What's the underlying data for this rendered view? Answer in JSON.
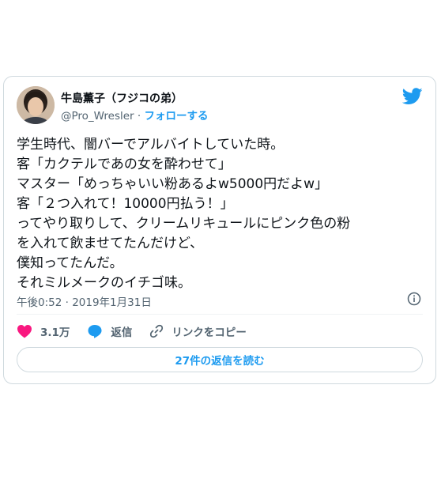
{
  "tweet": {
    "author_name": "牛島薫子（フジコの弟）",
    "handle": "@Pro_Wresler",
    "separator": " · ",
    "follow_label": "フォローする",
    "body_lines": [
      "学生時代、闇バーでアルバイトしていた時。",
      "客「カクテルであの女を酔わせて」",
      "マスター「めっちゃいい粉あるよw5000円だよw」",
      "客「２つ入れて！10000円払う！」",
      "ってやり取りして、クリームリキュールにピンク色の粉",
      "を入れて飲ませてたんだけど、",
      "僕知ってたんだ。",
      "それミルメークのイチゴ味。"
    ],
    "timestamp": "午後0:52 · 2019年1月31日",
    "likes_count": "3.1万",
    "reply_label": "返信",
    "copy_link_label": "リンクをコピー",
    "read_replies_label": "27件の返信を読む",
    "colors": {
      "accent": "#1d9bf0",
      "like": "#f91880",
      "text": "#0f1419",
      "muted": "#536471"
    },
    "icons": [
      "twitter-bird-icon",
      "info-icon",
      "heart-icon",
      "reply-bubble-icon",
      "link-icon"
    ]
  }
}
